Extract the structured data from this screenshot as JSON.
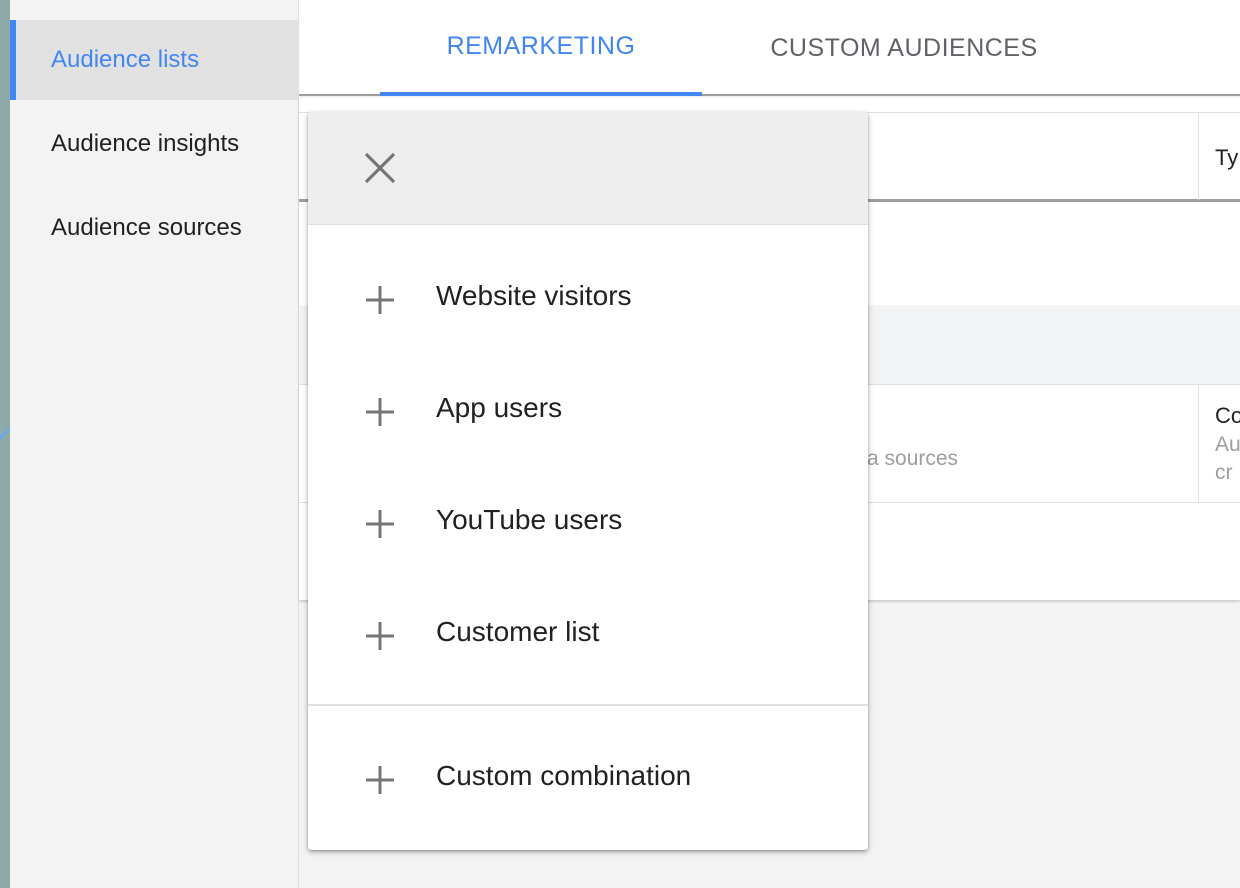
{
  "sidebar": {
    "items": [
      {
        "label": "Audience lists",
        "active": true
      },
      {
        "label": "Audience insights",
        "active": false
      },
      {
        "label": "Audience sources",
        "active": false
      }
    ]
  },
  "tabs": [
    {
      "label": "REMARKETING",
      "active": true
    },
    {
      "label": "CUSTOM AUDIENCES",
      "active": false
    }
  ],
  "table": {
    "header_type_partial": "Ty",
    "row": {
      "secondary_text_partial": "a sources",
      "type_title_partial": "Co",
      "type_desc_partial_1": "Au",
      "type_desc_partial_2": "cr"
    }
  },
  "menu": {
    "close_icon": "close-icon",
    "items": [
      {
        "label": "Website visitors",
        "icon": "plus-icon"
      },
      {
        "label": "App users",
        "icon": "plus-icon"
      },
      {
        "label": "YouTube users",
        "icon": "plus-icon"
      },
      {
        "label": "Customer list",
        "icon": "plus-icon"
      }
    ],
    "extra_item": {
      "label": "Custom combination",
      "icon": "plus-icon"
    }
  },
  "colors": {
    "accent": "#4285f4",
    "icon_gray": "#757575",
    "text": "#212121"
  }
}
